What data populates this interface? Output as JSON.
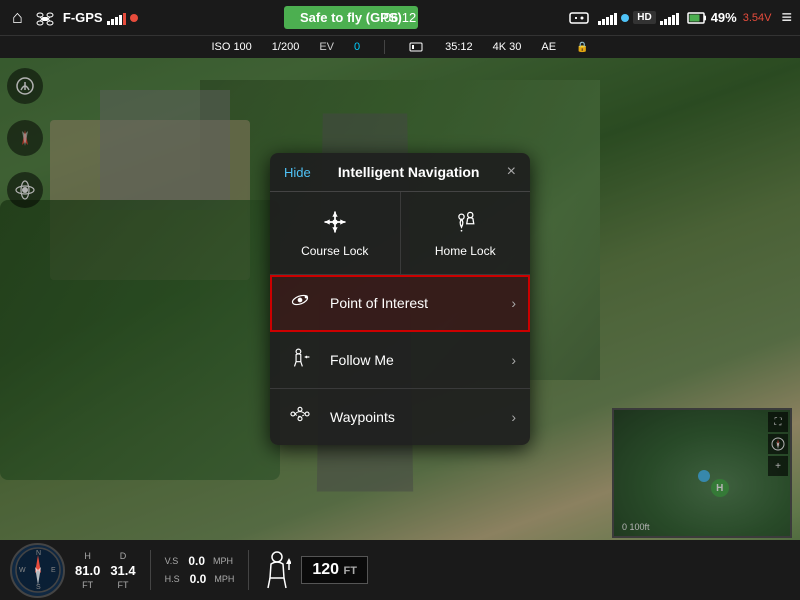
{
  "topBar": {
    "homeIcon": "⌂",
    "droneIcon": "✦",
    "gpsLabel": "F-GPS",
    "signalIcon": "📶",
    "safeToFly": "Safe to fly (GPS)",
    "rcIcon": "🎮",
    "hdLabel": "HD",
    "batteryPercent": "49%",
    "batteryVoltage": "3.54V",
    "menuIcon": "≡",
    "timer": "06:12",
    "iso": "ISO 100",
    "shutter": "1/200",
    "ev": "EV 0",
    "storage": "35:12",
    "resolution": "4K 30",
    "ae": "AE"
  },
  "sidebar": {
    "items": [
      {
        "icon": "🏔",
        "name": "takeoff-btn"
      },
      {
        "icon": "▲",
        "name": "nav-arrow"
      },
      {
        "icon": "◎",
        "name": "orbit-btn"
      }
    ]
  },
  "modal": {
    "hideLabel": "Hide",
    "title": "Intelligent Navigation",
    "closeLabel": "×",
    "topItems": [
      {
        "label": "Course Lock",
        "icon": "course-lock",
        "name": "course-lock-item"
      },
      {
        "label": "Home Lock",
        "icon": "home-lock",
        "name": "home-lock-item"
      }
    ],
    "listItems": [
      {
        "label": "Point of Interest",
        "icon": "poi",
        "name": "point-of-interest-item",
        "highlighted": true
      },
      {
        "label": "Follow Me",
        "icon": "follow-me",
        "name": "follow-me-item",
        "highlighted": false
      },
      {
        "label": "Waypoints",
        "icon": "waypoints",
        "name": "waypoints-item",
        "highlighted": false
      }
    ],
    "chevron": "›"
  },
  "telemetry": {
    "hLabel": "H",
    "hValue": "81.0",
    "hUnit": "FT",
    "dLabel": "D",
    "dValue": "31.4",
    "dUnit": "FT",
    "vsLabel": "V.S",
    "vsValue": "0.0",
    "vsUnit": "MPH",
    "hsLabel": "H.S",
    "hsValue": "0.0",
    "hsUnit": "MPH",
    "altValue": "120",
    "altUnit": "FT"
  },
  "minimap": {
    "scaleLabel": "0    100ft",
    "hMarker": "H"
  }
}
